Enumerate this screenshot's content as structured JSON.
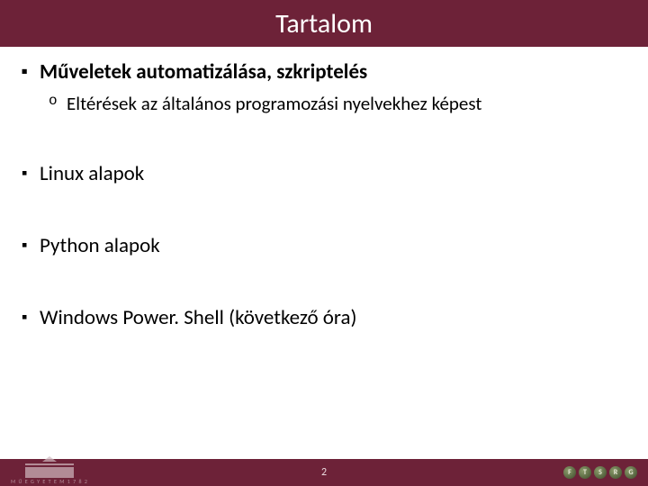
{
  "title": "Tartalom",
  "bullets": [
    {
      "text": "Műveletek automatizálása, szkriptelés",
      "bold": true,
      "sub": [
        "Eltérések az általános programozási nyelvekhez képest"
      ]
    },
    {
      "text": "Linux alapok",
      "bold": false,
      "sub": []
    },
    {
      "text": "Python alapok",
      "bold": false,
      "sub": []
    },
    {
      "text": "Windows Power. Shell (következő óra)",
      "bold": false,
      "sub": []
    }
  ],
  "footer": {
    "page_number": "2",
    "left_text": "M Ű E G Y E T E M  1 7 8 2",
    "right_badges": [
      "F",
      "T",
      "S",
      "R",
      "G"
    ]
  }
}
